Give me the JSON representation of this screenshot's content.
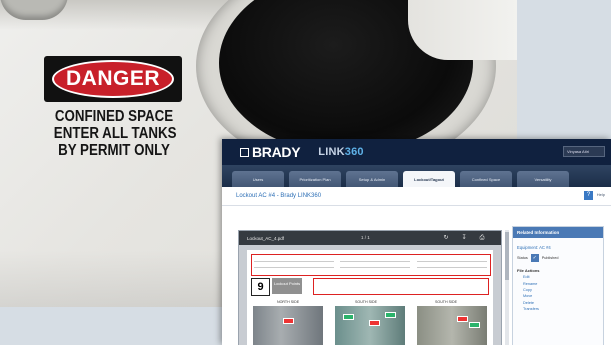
{
  "sign": {
    "header": "DANGER",
    "lines": [
      "CONFINED SPACE",
      "ENTER ALL TANKS",
      "BY PERMIT ONLY"
    ]
  },
  "app": {
    "brand": "BRADY",
    "product_prefix": "LINK",
    "product_suffix": "360",
    "user_select": "Vinyasa Atiri",
    "nav_tabs": [
      "Users",
      "Prioritization Plan",
      "Setup & Admin",
      "Lockout/Tagout",
      "Confined Space",
      "Versatility"
    ],
    "active_tab": "Lockout/Tagout",
    "page_title": "Lockout AC #4 - Brady LINK360",
    "help_label": "Help"
  },
  "viewer": {
    "filename": "Lockout_AC_4.pdf",
    "page_indicator": "1 / 1",
    "lockout_number": "9",
    "lockout_points_label": "Lockout Points",
    "sides": [
      "NORTH SIDE",
      "SOUTH SIDE",
      "SOUTH SIDE"
    ]
  },
  "related": {
    "title": "Related Information",
    "equipment": "Equipment: AC #4",
    "status_label": "Status",
    "status_value": "Published",
    "actions_title": "File Actions",
    "actions": [
      "Edit",
      "Rename",
      "Copy",
      "Move",
      "Delete",
      "Transfers"
    ]
  },
  "colors": {
    "danger_red": "#c8202a",
    "header_navy": "#10213f",
    "link_blue": "#2d6fb6"
  }
}
